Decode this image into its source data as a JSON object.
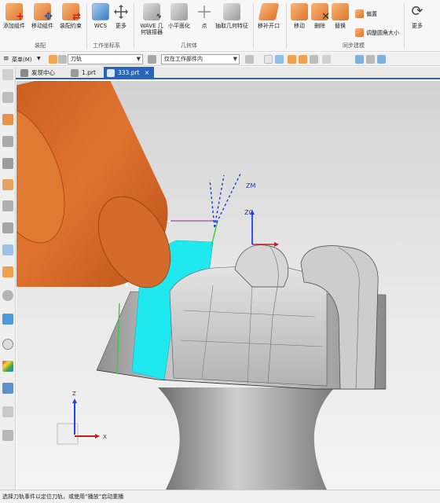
{
  "ribbon": {
    "assembly_buttons": [
      {
        "label": "添加组件"
      },
      {
        "label": "移动组件"
      },
      {
        "label": "装配约束"
      }
    ],
    "assembly_group": "装配",
    "csys_buttons": [
      {
        "label": "WCS"
      },
      {
        "label": "更多"
      }
    ],
    "csys_group": "工作坐标系",
    "geometry_buttons": [
      {
        "label": "WAVE 几何链接器"
      },
      {
        "label": "小平面化"
      },
      {
        "label": "点"
      },
      {
        "label": "抽取几何特征"
      }
    ],
    "geometry_group": "几何体",
    "slot_button": {
      "label": "移补开口"
    },
    "sync_buttons": [
      {
        "label": "移动"
      },
      {
        "label": "删除"
      },
      {
        "label": "替换"
      }
    ],
    "sync_small": [
      {
        "label": "偏置"
      },
      {
        "label": "调整圆角大小"
      }
    ],
    "sync_group": "同步建模",
    "more_button": {
      "label": "更多"
    }
  },
  "selbar": {
    "menu_label": "菜单(M)",
    "filter_value": "刀轨",
    "scope_value": "仅在工作部件内"
  },
  "tabs": [
    {
      "label": "发现中心"
    },
    {
      "label": "1.prt"
    },
    {
      "label": "333.prt",
      "active": true,
      "close": "×"
    }
  ],
  "viewport": {
    "label_zm": "ZM",
    "label_zc": "ZC",
    "triad_z": "Z",
    "triad_x": "X"
  },
  "colors": {
    "tool": "#d9692a",
    "cut_region": "#1fe8ef",
    "part": "#c6c6c6",
    "accent": "#2a64b8"
  },
  "status": {
    "text": "选择刀轨事件以定位刀轨，或使用“播放”启动重播"
  }
}
